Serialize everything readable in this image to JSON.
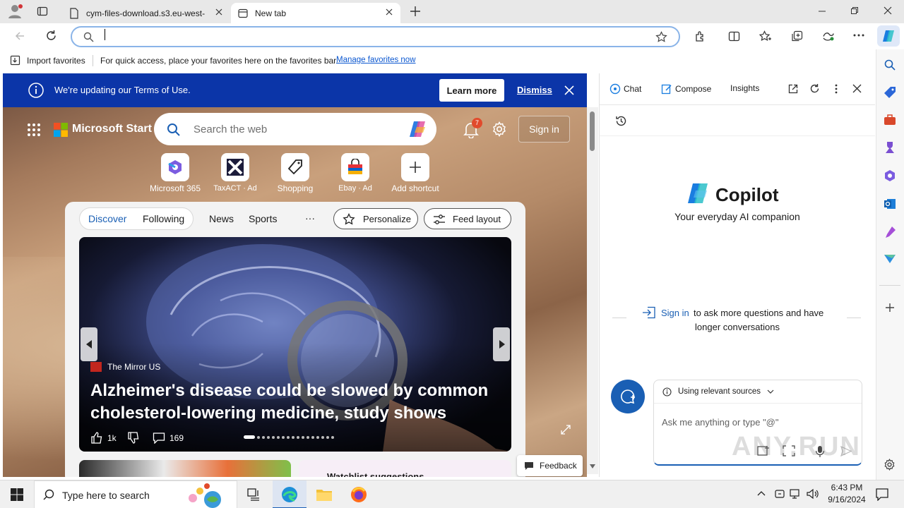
{
  "browser": {
    "tabs": [
      {
        "title": "cym-files-download.s3.eu-west-"
      },
      {
        "title": "New tab"
      }
    ],
    "address_value": ""
  },
  "favorites_bar": {
    "import_label": "Import favorites",
    "hint_text": "For quick access, place your favorites here on the favorites bar.",
    "manage_link": "Manage favorites now"
  },
  "banner": {
    "text": "We're updating our Terms of Use.",
    "learn_more": "Learn more",
    "dismiss": "Dismiss"
  },
  "start": {
    "brand": "Microsoft Start",
    "search_placeholder": "Search the web",
    "notification_count": "7",
    "sign_in": "Sign in",
    "shortcuts": [
      {
        "label": "Microsoft 365"
      },
      {
        "label": "TaxACT · Ad"
      },
      {
        "label": "Shopping"
      },
      {
        "label": "Ebay · Ad"
      },
      {
        "label": "Add shortcut"
      }
    ],
    "feed_tabs": [
      "Discover",
      "Following",
      "News",
      "Sports"
    ],
    "more": "···",
    "personalize": "Personalize",
    "feed_layout": "Feed layout",
    "hero": {
      "source": "The Mirror US",
      "headline_1": "Alzheimer's disease could be slowed by common",
      "headline_2": "cholesterol-lowering medicine, study shows",
      "likes": "1k",
      "comments": "169"
    },
    "watchlist_title": "Watchlist suggestions",
    "feedback": "Feedback"
  },
  "copilot": {
    "tabs": [
      "Chat",
      "Compose",
      "Insights"
    ],
    "title": "Copilot",
    "subtitle": "Your everyday AI companion",
    "signin_link": "Sign in",
    "signin_text_1": "to ask more questions and have",
    "signin_text_2": "longer conversations",
    "sources_label": "Using relevant sources",
    "input_placeholder": "Ask me anything or type \"@\""
  },
  "taskbar": {
    "search_placeholder": "Type here to search",
    "time": "6:43 PM",
    "date": "9/16/2024"
  },
  "watermark": "ANY.RUN"
}
